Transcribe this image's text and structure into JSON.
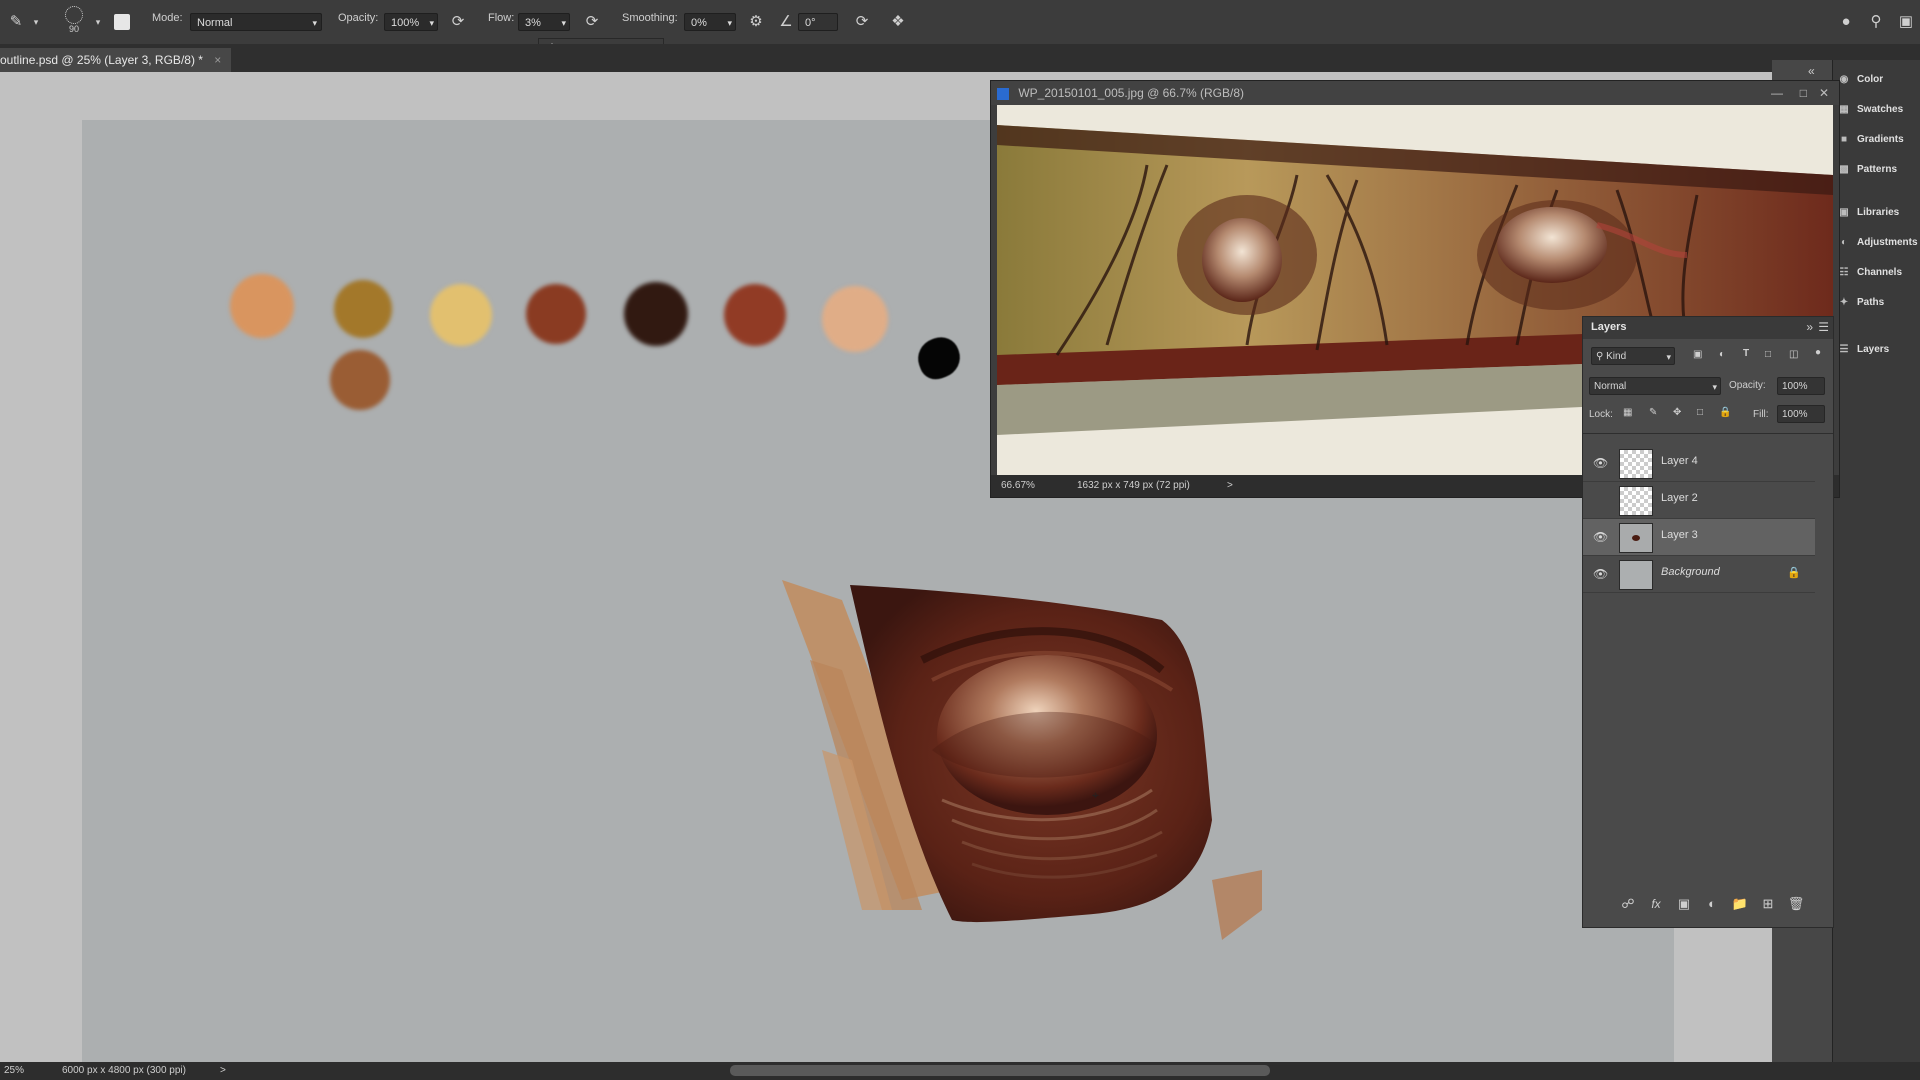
{
  "options_bar": {
    "brush_size": "90",
    "mode_label": "Mode:",
    "mode_value": "Normal",
    "opacity_label": "Opacity:",
    "opacity_value": "100%",
    "flow_label": "Flow:",
    "flow_value": "3%",
    "smoothing_label": "Smoothing:",
    "smoothing_value": "0%",
    "angle_value": "0°",
    "flow_slider_percent": 3
  },
  "document_tab": {
    "title": "outline.psd @ 25% (Layer 3, RGB/8) *",
    "close": "×"
  },
  "status_bar": {
    "zoom": "25%",
    "doc_size": "6000 px x 4800 px (300 ppi)",
    "arrow": ">"
  },
  "swatches": [
    {
      "color": "#d9955f"
    },
    {
      "color": "#a3782a"
    },
    {
      "color": "#e2c06f"
    },
    {
      "color": "#8a3b22"
    },
    {
      "color": "#311911"
    },
    {
      "color": "#913b25"
    },
    {
      "color": "#e0ad87"
    },
    {
      "color": "#9a5d34"
    },
    {
      "color": "#050505"
    }
  ],
  "photo_window": {
    "title": "WP_20150101_005.jpg @ 66.7% (RGB/8)",
    "zoom": "66.67%",
    "doc_size": "1632 px x 749 px (72 ppi)",
    "arrow": ">"
  },
  "right_dock": {
    "items": [
      {
        "label": "Color",
        "icon": "color-icon"
      },
      {
        "label": "Swatches",
        "icon": "swatches-icon"
      },
      {
        "label": "Gradients",
        "icon": "gradients-icon"
      },
      {
        "label": "Patterns",
        "icon": "patterns-icon"
      },
      {
        "label": "Libraries",
        "icon": "libraries-icon"
      },
      {
        "label": "Adjustments",
        "icon": "adjustments-icon"
      },
      {
        "label": "Channels",
        "icon": "channels-icon"
      },
      {
        "label": "Paths",
        "icon": "paths-icon"
      },
      {
        "label": "Layers",
        "icon": "layers-icon"
      }
    ]
  },
  "layers_panel": {
    "title": "Layers",
    "filter_kind": "Kind",
    "blend_mode": "Normal",
    "opacity_label": "Opacity:",
    "opacity_value": "100%",
    "lock_label": "Lock:",
    "fill_label": "Fill:",
    "fill_value": "100%",
    "layers": [
      {
        "name": "Layer 4",
        "visible": true,
        "selected": false
      },
      {
        "name": "Layer 2",
        "visible": false,
        "selected": false
      },
      {
        "name": "Layer 3",
        "visible": true,
        "selected": true
      },
      {
        "name": "Background",
        "visible": true,
        "selected": false,
        "locked": true
      }
    ]
  }
}
